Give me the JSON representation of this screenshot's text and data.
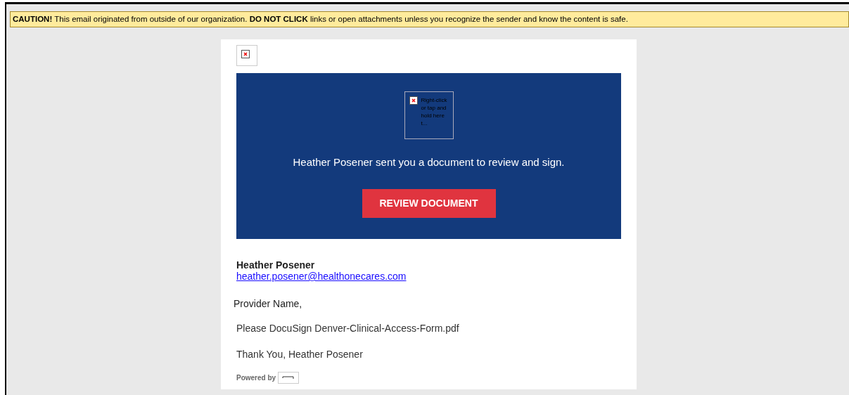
{
  "caution_banner": {
    "text": "**CAUTION!** This email originated from outside of our organization. **DO NOT CLICK** links or open attachments unless you recognize the sender and know the content is safe."
  },
  "email": {
    "hero": {
      "image_alt": "Right-click or tap and hold here t...",
      "message": "Heather Posener sent you a document to review and sign.",
      "button": "REVIEW DOCUMENT"
    },
    "sender": {
      "name": "Heather Posener",
      "email": "heather.posener@healthonecares.com"
    },
    "greeting": "Provider Name,",
    "body": "Please DocuSign Denver-Clinical-Access-Form.pdf",
    "signoff": "Thank You, Heather Posener",
    "footer": "Powered by"
  }
}
